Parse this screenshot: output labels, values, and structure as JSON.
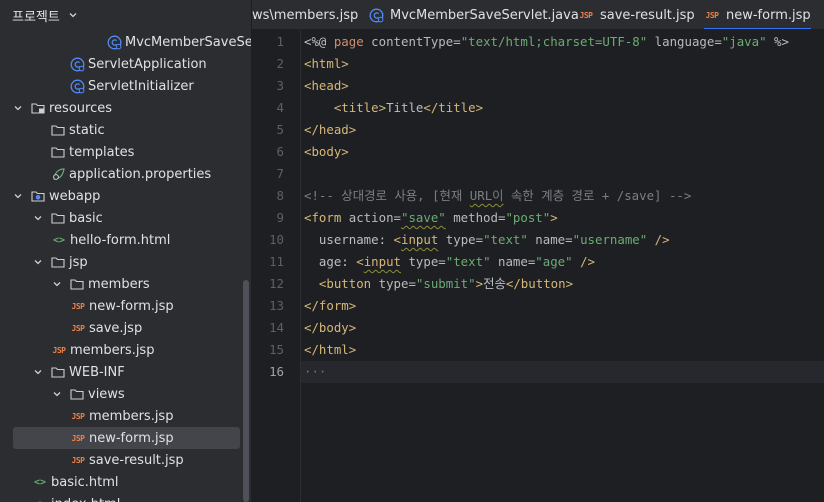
{
  "project": {
    "title": "프로젝트",
    "tree": [
      {
        "label": "MvcMemberSaveSer",
        "icon": "servlet-class-icon",
        "arrow": ""
      },
      {
        "label": "ServletApplication",
        "icon": "servlet-class-icon",
        "arrow": ""
      },
      {
        "label": "ServletInitializer",
        "icon": "servlet-class-icon",
        "arrow": ""
      },
      {
        "label": "resources",
        "icon": "resources-folder-icon",
        "arrow": "expanded"
      },
      {
        "label": "static",
        "icon": "folder-icon",
        "arrow": ""
      },
      {
        "label": "templates",
        "icon": "folder-icon",
        "arrow": ""
      },
      {
        "label": "application.properties",
        "icon": "properties-file-icon",
        "arrow": ""
      },
      {
        "label": "webapp",
        "icon": "web-folder-icon",
        "arrow": "expanded"
      },
      {
        "label": "basic",
        "icon": "folder-icon",
        "arrow": "expanded"
      },
      {
        "label": "hello-form.html",
        "icon": "html-file-icon",
        "arrow": ""
      },
      {
        "label": "jsp",
        "icon": "folder-icon",
        "arrow": "expanded"
      },
      {
        "label": "members",
        "icon": "folder-icon",
        "arrow": "expanded"
      },
      {
        "label": "new-form.jsp",
        "icon": "jsp-file-icon",
        "arrow": ""
      },
      {
        "label": "save.jsp",
        "icon": "jsp-file-icon",
        "arrow": ""
      },
      {
        "label": "members.jsp",
        "icon": "jsp-file-icon",
        "arrow": ""
      },
      {
        "label": "WEB-INF",
        "icon": "folder-icon",
        "arrow": "expanded"
      },
      {
        "label": "views",
        "icon": "folder-icon",
        "arrow": "expanded"
      },
      {
        "label": "members.jsp",
        "icon": "jsp-file-icon",
        "arrow": ""
      },
      {
        "label": "new-form.jsp",
        "icon": "jsp-file-icon",
        "arrow": "",
        "selected": true
      },
      {
        "label": "save-result.jsp",
        "icon": "jsp-file-icon",
        "arrow": ""
      },
      {
        "label": "basic.html",
        "icon": "html-file-icon",
        "arrow": ""
      },
      {
        "label": "index.html",
        "icon": "html-file-icon",
        "arrow": ""
      }
    ],
    "icon_labels": {
      "jsp": "JSP",
      "html": "<>"
    }
  },
  "tabs": [
    {
      "label": "ws\\members.jsp",
      "icon": "",
      "active": false
    },
    {
      "label": "MvcMemberSaveServlet.java",
      "icon": "servlet-class-icon",
      "active": false
    },
    {
      "label": "save-result.jsp",
      "icon": "jsp-file-icon",
      "active": false
    },
    {
      "label": "new-form.jsp",
      "icon": "jsp-file-icon",
      "active": true
    }
  ],
  "editor": {
    "current_line": 16,
    "lines": [
      [
        [
          "t-dir",
          "<%@ "
        ],
        [
          "t-kw",
          "page "
        ],
        [
          "t-attr",
          "contentType="
        ],
        [
          "t-str",
          "\"text/html;charset=UTF-8\""
        ],
        [
          "t-attr",
          " language="
        ],
        [
          "t-str",
          "\"java\""
        ],
        [
          "t-dir",
          " %>"
        ]
      ],
      [
        [
          "t-tag",
          "<html>"
        ]
      ],
      [
        [
          "t-tag",
          "<head>"
        ]
      ],
      [
        [
          "t-text",
          "    "
        ],
        [
          "t-tag",
          "<title>"
        ],
        [
          "t-text",
          "Title"
        ],
        [
          "t-tag",
          "</title>"
        ]
      ],
      [
        [
          "t-tag",
          "</head>"
        ]
      ],
      [
        [
          "t-tag",
          "<body>"
        ]
      ],
      [],
      [
        [
          "t-cmt",
          "<!-- 상대경로 사용, [현재 "
        ],
        [
          "t-cmt squiggle",
          "URL이"
        ],
        [
          "t-cmt",
          " 속한 계층 경로 + /save] -->"
        ]
      ],
      [
        [
          "t-tag",
          "<form "
        ],
        [
          "t-attr",
          "action="
        ],
        [
          "t-str squiggle",
          "\"save\""
        ],
        [
          "t-attr",
          " method="
        ],
        [
          "t-str",
          "\"post\""
        ],
        [
          "t-tag",
          ">"
        ]
      ],
      [
        [
          "t-text",
          "  username: "
        ],
        [
          "t-tag",
          "<"
        ],
        [
          "t-tag squiggle",
          "input"
        ],
        [
          "t-attr",
          " type="
        ],
        [
          "t-str",
          "\"text\""
        ],
        [
          "t-attr",
          " name="
        ],
        [
          "t-str",
          "\"username\""
        ],
        [
          "t-tag",
          " />"
        ]
      ],
      [
        [
          "t-text",
          "  age: "
        ],
        [
          "t-tag",
          "<"
        ],
        [
          "t-tag squiggle",
          "input"
        ],
        [
          "t-attr",
          " type="
        ],
        [
          "t-str",
          "\"text\""
        ],
        [
          "t-attr",
          " name="
        ],
        [
          "t-str",
          "\"age\""
        ],
        [
          "t-tag",
          " />"
        ]
      ],
      [
        [
          "t-text",
          "  "
        ],
        [
          "t-tag",
          "<button "
        ],
        [
          "t-attr",
          "type="
        ],
        [
          "t-str",
          "\"submit\""
        ],
        [
          "t-tag",
          ">"
        ],
        [
          "t-text",
          "전송"
        ],
        [
          "t-tag",
          "</button>"
        ]
      ],
      [
        [
          "t-tag",
          "</form>"
        ]
      ],
      [
        [
          "t-tag",
          "</body>"
        ]
      ],
      [
        [
          "t-tag",
          "</html>"
        ]
      ],
      [
        [
          "t-ellipsis",
          "···"
        ]
      ]
    ]
  },
  "colors": {
    "accent": "#3574f0",
    "selection": "#43454a",
    "panel": "#2b2d30",
    "editor": "#1e1f22"
  }
}
